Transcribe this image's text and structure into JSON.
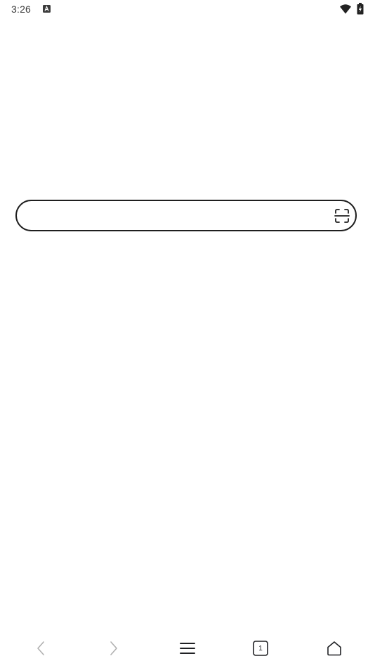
{
  "status_bar": {
    "time": "3:26",
    "notification_icon": "a-notification-icon",
    "wifi_icon": "wifi-icon",
    "battery_icon": "battery-charging-icon"
  },
  "search": {
    "value": "",
    "placeholder": "",
    "scan_icon": "scan-icon"
  },
  "bottom_nav": {
    "back_icon": "chevron-left-icon",
    "forward_icon": "chevron-right-icon",
    "menu_icon": "menu-icon",
    "tabs_count": "1",
    "home_icon": "home-icon"
  },
  "colors": {
    "background": "#ffffff",
    "outline": "#1f1f1f",
    "disabled": "#b0b0b0",
    "icon": "#202124"
  }
}
